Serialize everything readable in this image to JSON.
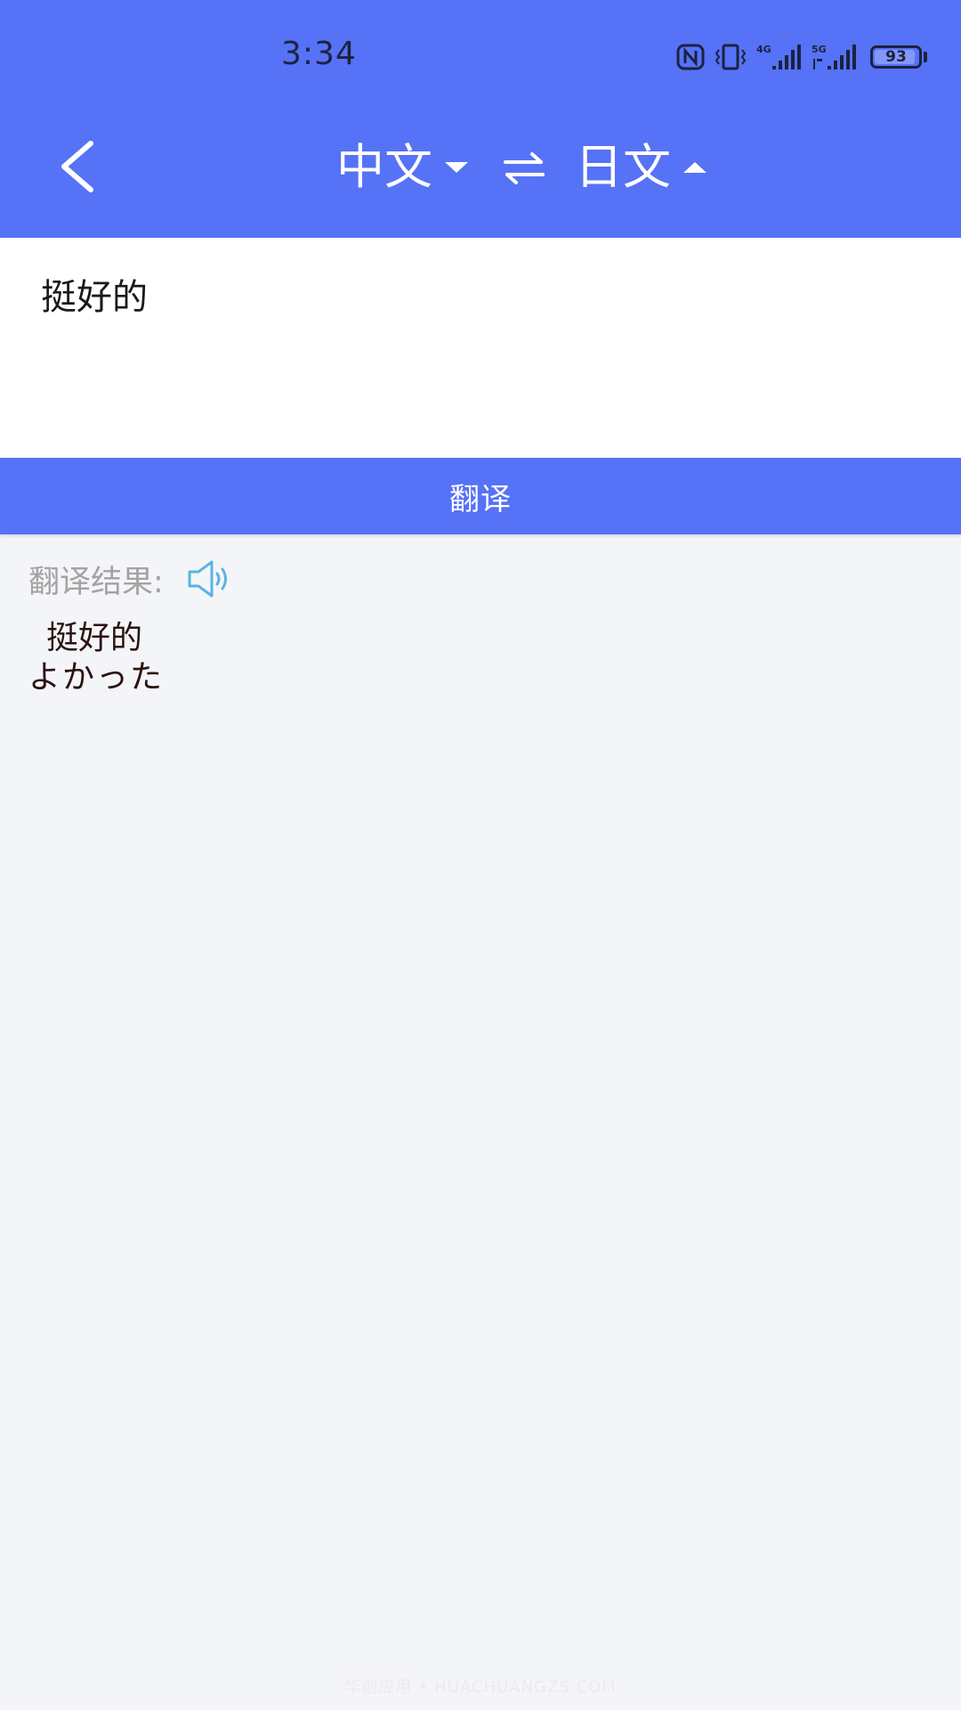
{
  "status_bar": {
    "time": "3:34",
    "battery": "93",
    "battery_level": 0.93,
    "network_labels": [
      "4G",
      "5G"
    ],
    "icons": [
      "nfc-icon",
      "vibrate-icon",
      "signal-4g-icon",
      "signal-5g-icon",
      "battery-icon"
    ]
  },
  "nav": {
    "back_icon": "chevron-left-icon",
    "source_lang": "中文",
    "target_lang": "日文",
    "swap_icon": "swap-arrows-icon"
  },
  "input": {
    "value": "挺好的"
  },
  "actions": {
    "translate_label": "翻译"
  },
  "result": {
    "label": "翻译结果:",
    "speaker_icon": "speaker-icon",
    "source_text": "挺好的",
    "translation": "よかった"
  },
  "watermark": "华创应用 • HUACHUANGZS.COM",
  "colors": {
    "primary": "#5672f6",
    "background": "#f4f5f8",
    "speaker": "#5ab4e0",
    "result_label": "#a3a3a3",
    "result_text": "#2a1310"
  }
}
